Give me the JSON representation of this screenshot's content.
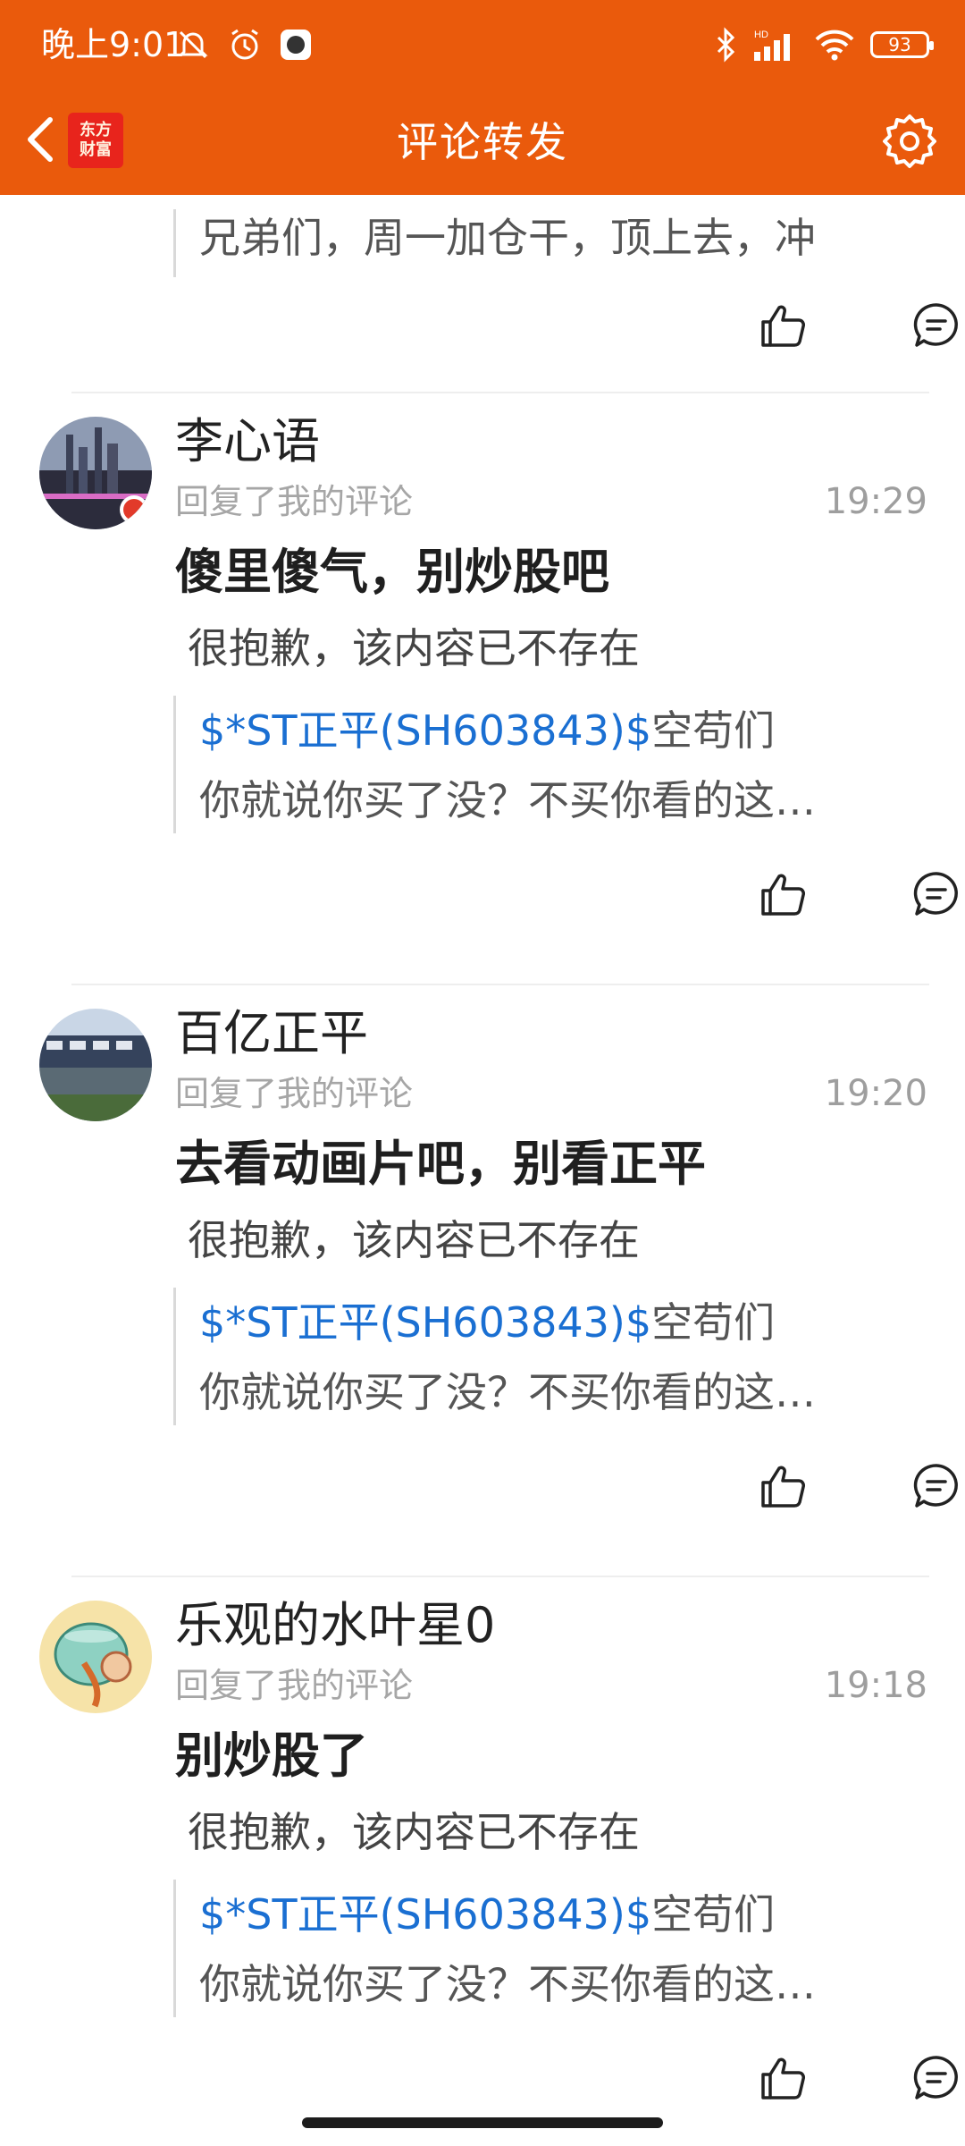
{
  "status_bar": {
    "time": "晚上9:01",
    "battery": "93"
  },
  "nav": {
    "title": "评论转发",
    "logo_line1": "东方",
    "logo_line2": "财富"
  },
  "top_partial": {
    "quote": "兄弟们，周一加仓干，顶上去，冲"
  },
  "comments": [
    {
      "username": "李心语",
      "subtitle": "回复了我的评论",
      "time": "19:29",
      "text": "傻里傻气，别炒股吧",
      "deleted": "很抱歉，该内容已不存在",
      "stock": "$*ST正平(SH603843)$",
      "quote_rest": "空苟们",
      "quote_line2": "你就说你买了没？不买你看的这…"
    },
    {
      "username": "百亿正平",
      "subtitle": "回复了我的评论",
      "time": "19:20",
      "text": "去看动画片吧，别看正平",
      "deleted": "很抱歉，该内容已不存在",
      "stock": "$*ST正平(SH603843)$",
      "quote_rest": "空苟们",
      "quote_line2": "你就说你买了没？不买你看的这…"
    },
    {
      "username": "乐观的水叶星0",
      "subtitle": "回复了我的评论",
      "time": "19:18",
      "text": "别炒股了",
      "deleted": "很抱歉，该内容已不存在",
      "stock": "$*ST正平(SH603843)$",
      "quote_rest": "空苟们",
      "quote_line2": "你就说你买了没？不买你看的这…"
    }
  ],
  "colors": {
    "brand_orange": "#ea5a0c",
    "link_blue": "#1a6fd2"
  }
}
